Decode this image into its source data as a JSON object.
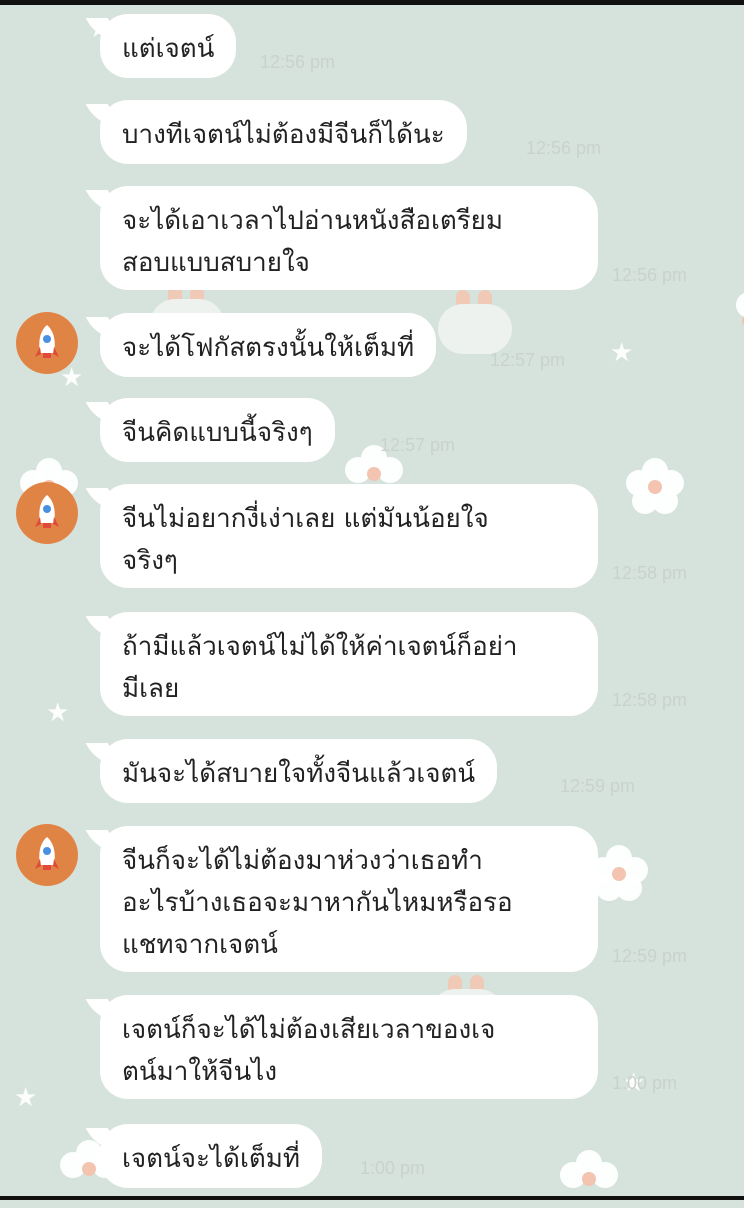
{
  "chat": {
    "messages": [
      {
        "text": "แต่เจตน์",
        "time": "12:56 pm",
        "avatar": false
      },
      {
        "text": "บางทีเจตน์ไม่ต้องมีจีนก็ได้นะ",
        "time": "12:56 pm",
        "avatar": false
      },
      {
        "text": "จะได้เอาเวลาไปอ่านหนังสือเตรียม\nสอบแบบสบายใจ",
        "time": "12:56 pm",
        "avatar": false
      },
      {
        "text": "จะได้โฟกัสตรงนั้นให้เต็มที่",
        "time": "12:57 pm",
        "avatar": true
      },
      {
        "text": "จีนคิดแบบนี้จริงๆ",
        "time": "12:57 pm",
        "avatar": false
      },
      {
        "text": "จีนไม่อยากงี่เง่าเลย แต่มันน้อยใจ\nจริงๆ",
        "time": "12:58 pm",
        "avatar": true
      },
      {
        "text": "ถ้ามีแล้วเจตน์ไม่ได้ให้ค่าเจตน์ก็อย่า\nมีเลย",
        "time": "12:58 pm",
        "avatar": false
      },
      {
        "text": "มันจะได้สบายใจทั้งจีนแล้วเจตน์",
        "time": "12:59 pm",
        "avatar": false
      },
      {
        "text": "จีนก็จะได้ไม่ต้องมาห่วงว่าเธอทำ\nอะไรบ้างเธอจะมาหากันไหมหรือรอ\nแชทจากเจตน์",
        "time": "12:59 pm",
        "avatar": true
      },
      {
        "text": "เจตน์ก็จะได้ไม่ต้องเสียเวลาของเจ\nตน์มาให้จีนไง",
        "time": "1:00 pm",
        "avatar": false
      },
      {
        "text": "เจตน์จะได้เต็มที่",
        "time": "1:00 pm",
        "avatar": false
      }
    ],
    "avatar_icon": "rocket-icon",
    "colors": {
      "background": "#d6e3dc",
      "bubble": "#ffffff",
      "avatar": "#e08445",
      "timestamp": "#c9d2cd"
    }
  }
}
